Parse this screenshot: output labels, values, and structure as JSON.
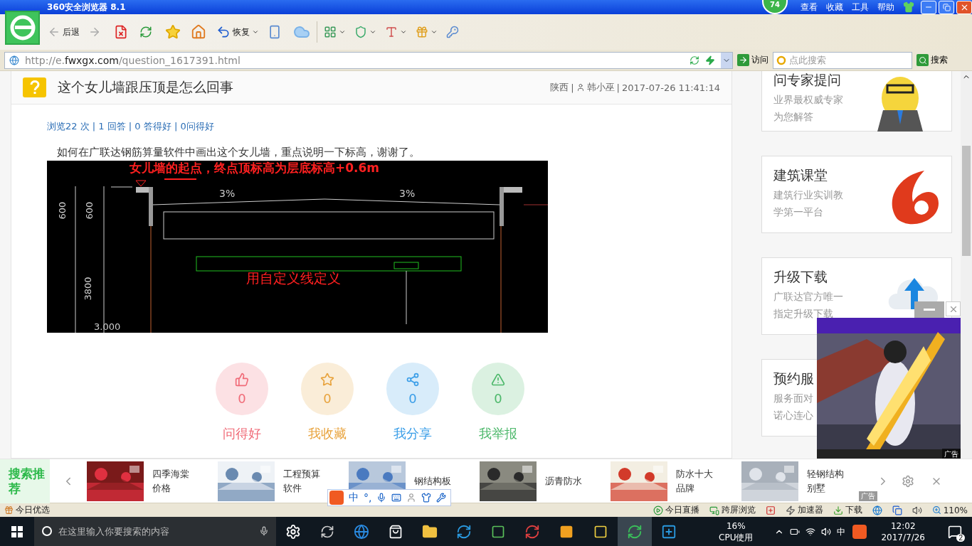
{
  "window": {
    "title": "360安全浏览器 8.1",
    "badge": "74",
    "menu": [
      "查看",
      "收藏",
      "工具",
      "帮助"
    ]
  },
  "toolbar": {
    "back": "后退",
    "restore": "恢复"
  },
  "address": {
    "scheme": "http://e.",
    "host": "fwxgx.com",
    "path": "/question_1617391.html",
    "go": "访问",
    "search_placeholder": "点此搜索",
    "search_button": "搜索"
  },
  "question": {
    "title": "这个女儿墙跟压顶是怎么回事",
    "region": "陕西",
    "user": "韩小巫",
    "time": "2017-07-26 11:41:14",
    "separator": "|",
    "stats": "浏览22 次 | 1 回答 | 0 答得好 | 0问得好",
    "body": "如何在广联达钢筋算量软件中画出这个女儿墙，重点说明一下标高，谢谢了。",
    "drawing": {
      "annotation": "女儿墙的起点，终点顶标高为层底标高+0.6m",
      "note": "用自定义线定义",
      "slopes": [
        "3%",
        "3%"
      ],
      "dims": [
        "600",
        "600",
        "3800",
        "3.000"
      ]
    }
  },
  "actions": [
    {
      "kind": "like",
      "count": "0",
      "label": "问得好",
      "color": "#f06b78"
    },
    {
      "kind": "favorite",
      "count": "0",
      "label": "我收藏",
      "color": "#e8a33d"
    },
    {
      "kind": "share",
      "count": "0",
      "label": "我分享",
      "color": "#3a9ee8"
    },
    {
      "kind": "report",
      "count": "0",
      "label": "我举报",
      "color": "#4cb86a"
    }
  ],
  "sidebar": [
    {
      "kind": "expert",
      "title": "问专家提问",
      "lines": [
        "业界最权威专家",
        "为您解答"
      ]
    },
    {
      "kind": "course",
      "title": "建筑课堂",
      "lines": [
        "建筑行业实训教",
        "学第一平台"
      ]
    },
    {
      "kind": "download",
      "title": "升级下载",
      "lines": [
        "广联达官方唯一",
        "指定升级下载"
      ]
    },
    {
      "kind": "service",
      "title": "预约服",
      "lines": [
        "服务面对",
        "诺心连心"
      ]
    }
  ],
  "floating_ad": {
    "tag": "广告"
  },
  "recommend": {
    "title": "搜索推荐",
    "tag": "广告",
    "items": [
      {
        "label": "四季海棠价格",
        "kind": "flower"
      },
      {
        "label": "工程预算软件",
        "kind": "sheet"
      },
      {
        "label": "钢结构板",
        "kind": "house"
      },
      {
        "label": "沥青防水",
        "kind": "road"
      },
      {
        "label": "防水十大品牌",
        "kind": "certificate"
      },
      {
        "label": "轻钢结构别墅",
        "kind": "frame"
      }
    ]
  },
  "ime": {
    "mode": "中",
    "punct": "°,"
  },
  "status_bar": {
    "left": "今日优选",
    "items": [
      {
        "kind": "live",
        "label": "今日直播"
      },
      {
        "kind": "screen",
        "label": "跨屏浏览"
      },
      {
        "kind": "plus"
      },
      {
        "kind": "speed",
        "label": "加速器"
      },
      {
        "kind": "download",
        "label": "下载"
      }
    ],
    "zoom": "110%"
  },
  "taskbar": {
    "search_placeholder": "在这里输入你要搜索的内容",
    "cpu": "16%",
    "cpu_label": "CPU使用",
    "ime": "中",
    "time": "12:02",
    "date": "2017/7/26",
    "notifications": "2"
  }
}
